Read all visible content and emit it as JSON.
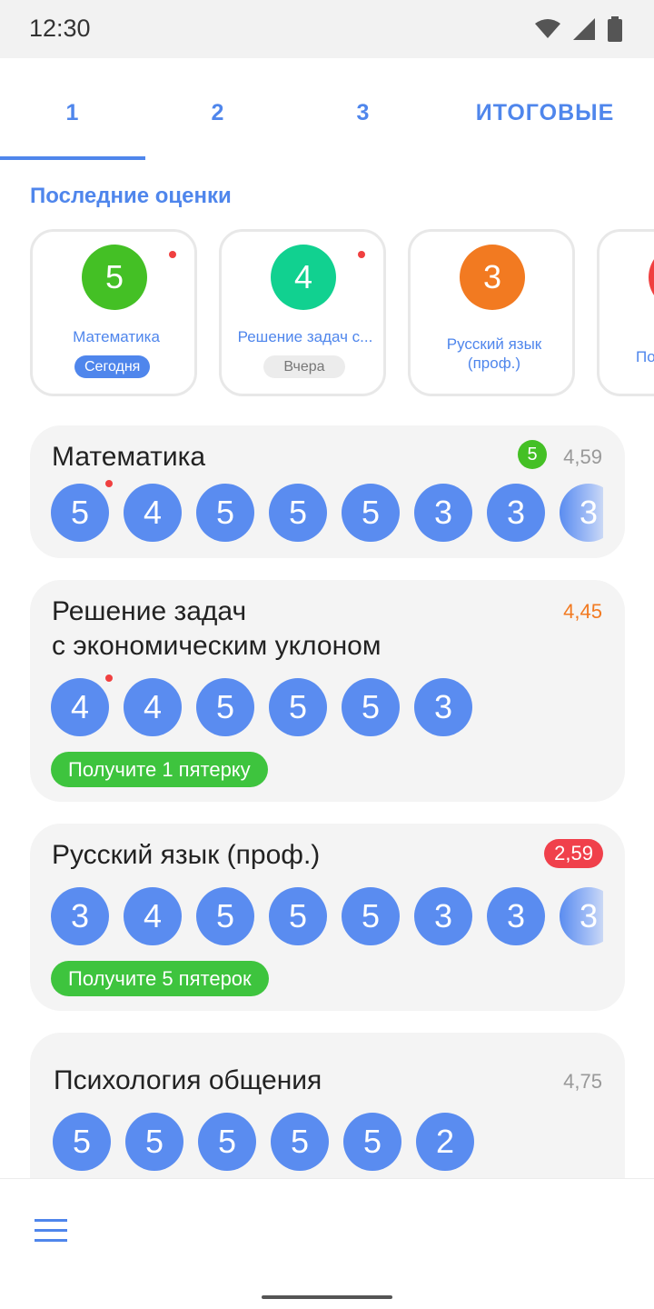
{
  "status": {
    "time": "12:30"
  },
  "tabs": [
    "1",
    "2",
    "3",
    "ИТОГОВЫЕ"
  ],
  "recent": {
    "title": "Последние оценки",
    "items": [
      {
        "grade": "5",
        "subject": "Математика",
        "date": "Сегодня",
        "color": "#44c025",
        "new": true
      },
      {
        "grade": "4",
        "subject": "Решение задач с...",
        "date": "Вчера",
        "color": "#11d190",
        "new": true
      },
      {
        "grade": "3",
        "subject": "Русский язык (проф.)",
        "date": "",
        "color": "#f27a21",
        "new": false
      },
      {
        "grade": "",
        "subject": "По",
        "date": "",
        "color": "#f04040",
        "new": false
      }
    ]
  },
  "subjects": [
    {
      "name": "Математика",
      "final_badge": "5",
      "average": "4,59",
      "average_color": "#999999",
      "grades": [
        "5",
        "4",
        "5",
        "5",
        "5",
        "3",
        "3",
        "3"
      ],
      "new_first": true,
      "goal": ""
    },
    {
      "name_line1": "Решение задач",
      "name_line2": "с экономическим уклоном",
      "average": "4,45",
      "average_color": "#f27a21",
      "grades": [
        "4",
        "4",
        "5",
        "5",
        "5",
        "3"
      ],
      "new_first": true,
      "goal": "Получите 1 пятерку"
    },
    {
      "name": "Русский язык (проф.)",
      "average": "2,59",
      "average_color": "#ffffff",
      "average_bg": "#f0404b",
      "grades": [
        "3",
        "4",
        "5",
        "5",
        "5",
        "3",
        "3",
        "3"
      ],
      "new_first": false,
      "goal": "Получите 5 пятерок"
    },
    {
      "name": "Психология общения",
      "average": "4,75",
      "average_color": "#999999",
      "grades": [
        "5",
        "5",
        "5",
        "5",
        "5",
        "2"
      ],
      "new_first": false,
      "goal": ""
    }
  ],
  "colors": {
    "accent": "#4f86ec",
    "grade_bg": "#5a8cf0",
    "goal_bg": "#3ec43e"
  },
  "icons": [
    "wifi-icon",
    "signal-icon",
    "battery-icon",
    "menu-icon"
  ]
}
